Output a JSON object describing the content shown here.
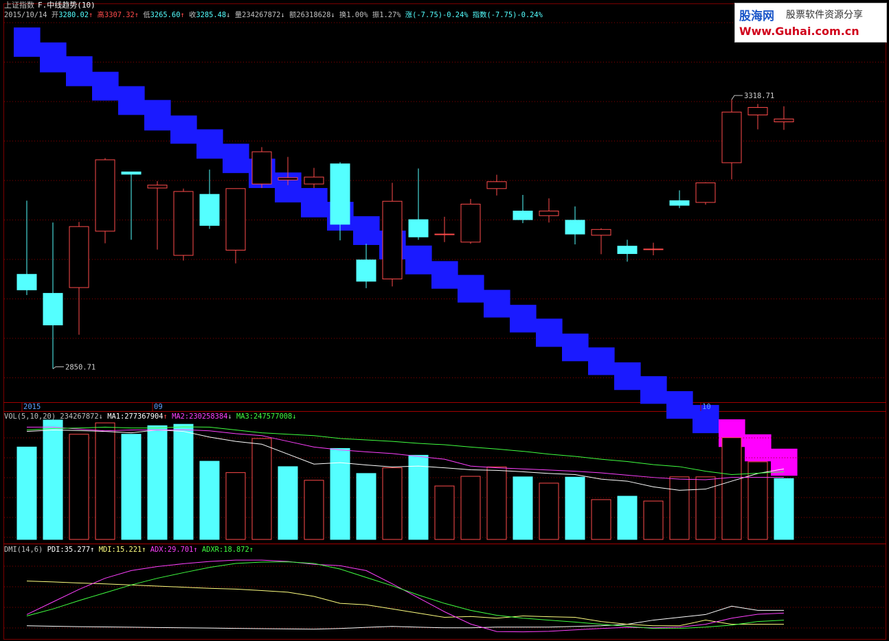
{
  "header": {
    "instrument": "上证指数",
    "formula": "F.中线趋势(10)",
    "date": "2015/10/14",
    "open_label": "开",
    "open": "3280.02",
    "open_arrow": "↑",
    "high_label": "高",
    "high": "3307.32",
    "high_arrow": "↑",
    "low_label": "低",
    "low": "3265.60",
    "low_arrow": "↑",
    "close_label": "收",
    "close": "3285.48",
    "close_arrow": "↓",
    "volume_label": "量",
    "volume": "234267872",
    "volume_arrow": "↓",
    "amount_label": "额",
    "amount": "26318628",
    "amount_arrow": "↓",
    "turnover": "换1.00%",
    "amplitude": "振1.27%",
    "change": "涨(-7.75)-0.24%",
    "index_change": "指数(-7.75)-0.24%"
  },
  "logo": {
    "name": "股海网",
    "slogan": "股票软件资源分享",
    "url": "Www.Guhai.com.cn"
  },
  "vol_header": {
    "title": "VOL(5,10,20)",
    "value": "234267872",
    "value_arrow": "↓",
    "ma1_label": "MA1:",
    "ma1": "277367904",
    "ma1_arrow": "↑",
    "ma2_label": "MA2:",
    "ma2": "230258384",
    "ma2_arrow": "↓",
    "ma3_label": "MA3:",
    "ma3": "247577008",
    "ma3_arrow": "↓"
  },
  "dmi_header": {
    "title": "DMI(14,6)",
    "pdi_label": "PDI:",
    "pdi": "35.277",
    "pdi_arrow": "↑",
    "mdi_label": "MDI:",
    "mdi": "15.221",
    "mdi_arrow": "↑",
    "adx_label": "ADX:",
    "adx": "29.701",
    "adx_arrow": "↑",
    "adxr_label": "ADXR:",
    "adxr": "18.872",
    "adxr_arrow": "↑"
  },
  "colors": {
    "background": "#000000",
    "up": "#ff4b4b",
    "down": "#54ffff",
    "trend_band": "#1a1aff",
    "trend_band_up": "#ff00ff",
    "grid": "#8b0000",
    "ma1": "#ffffff",
    "ma2": "#ff40ff",
    "ma3": "#40ff40",
    "pdi": "#ffffff",
    "mdi": "#ffff80",
    "adx": "#ff40ff",
    "adxr": "#40ff40"
  },
  "chart_data": [
    {
      "type": "candlestick",
      "title": "上证指数",
      "x_labels": [
        {
          "index": 0,
          "text": "2015"
        },
        {
          "index": 5,
          "text": "09"
        },
        {
          "index": 26,
          "text": "10"
        }
      ],
      "ylim": [
        2800,
        3450
      ],
      "annotations": [
        {
          "index": 1,
          "value": 2850.71,
          "text": "2850.71",
          "kind": "low"
        },
        {
          "index": 27,
          "value": 3318.71,
          "text": "3318.71",
          "kind": "high"
        }
      ],
      "candles": [
        {
          "o": 3015,
          "h": 3143,
          "l": 2979,
          "c": 2988
        },
        {
          "o": 2982,
          "h": 3105,
          "l": 2851,
          "c": 2927
        },
        {
          "o": 2992,
          "h": 3106,
          "l": 2910,
          "c": 3098
        },
        {
          "o": 3090,
          "h": 3217,
          "l": 3069,
          "c": 3214
        },
        {
          "o": 3193,
          "h": 3193,
          "l": 3075,
          "c": 3189
        },
        {
          "o": 3165,
          "h": 3177,
          "l": 3058,
          "c": 3170
        },
        {
          "o": 3048,
          "h": 3164,
          "l": 3039,
          "c": 3159
        },
        {
          "o": 3154,
          "h": 3197,
          "l": 3094,
          "c": 3100
        },
        {
          "o": 3057,
          "h": 3156,
          "l": 3034,
          "c": 3164
        },
        {
          "o": 3172,
          "h": 3236,
          "l": 3165,
          "c": 3228
        },
        {
          "o": 3179,
          "h": 3219,
          "l": 3170,
          "c": 3183
        },
        {
          "o": 3172,
          "h": 3200,
          "l": 3165,
          "c": 3184
        },
        {
          "o": 3207,
          "h": 3210,
          "l": 3074,
          "c": 3102
        },
        {
          "o": 3040,
          "h": 3068,
          "l": 2991,
          "c": 3003
        },
        {
          "o": 3007,
          "h": 3174,
          "l": 2994,
          "c": 3142
        },
        {
          "o": 3110,
          "h": 3199,
          "l": 3075,
          "c": 3080
        },
        {
          "o": 3085,
          "h": 3115,
          "l": 3071,
          "c": 3085
        },
        {
          "o": 3071,
          "h": 3146,
          "l": 3068,
          "c": 3137
        },
        {
          "o": 3164,
          "h": 3188,
          "l": 3152,
          "c": 3176
        },
        {
          "o": 3125,
          "h": 3153,
          "l": 3104,
          "c": 3110
        },
        {
          "o": 3117,
          "h": 3147,
          "l": 3105,
          "c": 3125
        },
        {
          "o": 3109,
          "h": 3133,
          "l": 3067,
          "c": 3085
        },
        {
          "o": 3083,
          "h": 3095,
          "l": 3050,
          "c": 3093
        },
        {
          "o": 3064,
          "h": 3075,
          "l": 3037,
          "c": 3051
        },
        {
          "o": 3059,
          "h": 3070,
          "l": 3048,
          "c": 3059
        },
        {
          "o": 3143,
          "h": 3161,
          "l": 3130,
          "c": 3135
        },
        {
          "o": 3140,
          "h": 3175,
          "l": 3136,
          "c": 3174
        },
        {
          "o": 3209,
          "h": 3319,
          "l": 3180,
          "c": 3297
        },
        {
          "o": 3292,
          "h": 3311,
          "l": 3267,
          "c": 3305
        },
        {
          "o": 3280,
          "h": 3307,
          "l": 3266,
          "c": 3285
        }
      ],
      "trend_band": {
        "upper": [
          3444,
          3418,
          3394,
          3367,
          3342,
          3318,
          3291,
          3267,
          3242,
          3216,
          3192,
          3165,
          3141,
          3116,
          3091,
          3065,
          3038,
          3014,
          2988,
          2962,
          2938,
          2912,
          2888,
          2862,
          2838,
          2812,
          2788,
          2763,
          2737,
          2712
        ],
        "lower": [
          3393,
          3366,
          3342,
          3317,
          3292,
          3265,
          3242,
          3216,
          3191,
          3165,
          3140,
          3114,
          3091,
          3066,
          3041,
          3015,
          2990,
          2966,
          2940,
          2914,
          2889,
          2864,
          2840,
          2814,
          2790,
          2764,
          2739,
          2715,
          2690,
          2665
        ],
        "up_from_index": 27
      }
    },
    {
      "type": "bar",
      "title": "VOL(5,10,20)",
      "ylim": [
        0,
        420000000
      ],
      "values": [
        325000000,
        432000000,
        370000000,
        410000000,
        370000000,
        400000000,
        405000000,
        275000000,
        235000000,
        355000000,
        256000000,
        208000000,
        320000000,
        232000000,
        252000000,
        296000000,
        188000000,
        222000000,
        255000000,
        220000000,
        198000000,
        219000000,
        140000000,
        152000000,
        135000000,
        220000000,
        220000000,
        358000000,
        273000000,
        214000000
      ],
      "up": [
        false,
        false,
        true,
        true,
        false,
        false,
        false,
        false,
        true,
        true,
        false,
        true,
        false,
        false,
        true,
        false,
        true,
        true,
        true,
        false,
        true,
        false,
        true,
        false,
        true,
        true,
        true,
        true,
        true,
        false
      ],
      "series": [
        {
          "name": "MA1",
          "values": [
            380000000,
            385000000,
            383000000,
            380000000,
            375000000,
            385000000,
            380000000,
            360000000,
            345000000,
            335000000,
            300000000,
            265000000,
            270000000,
            262000000,
            255000000,
            258000000,
            252000000,
            245000000,
            243000000,
            238000000,
            232000000,
            228000000,
            212000000,
            205000000,
            185000000,
            173000000,
            177000000,
            205000000,
            232000000,
            248000000
          ]
        },
        {
          "name": "MA2",
          "values": [
            395000000,
            395000000,
            388000000,
            382000000,
            385000000,
            385000000,
            386000000,
            382000000,
            372000000,
            365000000,
            345000000,
            325000000,
            315000000,
            308000000,
            302000000,
            292000000,
            282000000,
            258000000,
            252000000,
            248000000,
            244000000,
            240000000,
            234000000,
            226000000,
            218000000,
            212000000,
            210000000,
            218000000,
            218000000,
            218000000
          ]
        },
        {
          "name": "MA3",
          "values": [
            385000000,
            390000000,
            392000000,
            395000000,
            392000000,
            392000000,
            396000000,
            395000000,
            385000000,
            375000000,
            370000000,
            365000000,
            355000000,
            350000000,
            345000000,
            338000000,
            333000000,
            325000000,
            318000000,
            310000000,
            300000000,
            292000000,
            282000000,
            274000000,
            263000000,
            256000000,
            240000000,
            228000000,
            233000000,
            238000000
          ]
        }
      ]
    },
    {
      "type": "line",
      "title": "DMI(14,6)",
      "ylim": [
        5,
        65
      ],
      "series": [
        {
          "name": "PDI",
          "values": [
            14,
            13.6,
            13.3,
            13.1,
            12.9,
            12.7,
            12.5,
            12.3,
            12.1,
            11.9,
            11.7,
            11.5,
            12.0,
            12.8,
            13.5,
            12.9,
            12.5,
            12.5,
            13.0,
            13.0,
            13.0,
            13.5,
            14.0,
            15.0,
            18.0,
            20.0,
            22.0,
            28.0,
            25.0,
            25.0
          ]
        },
        {
          "name": "MDI",
          "values": [
            46,
            45.4,
            44.6,
            44.0,
            43.2,
            42.4,
            41.6,
            40.8,
            40.2,
            39.2,
            38.0,
            35.0,
            30.0,
            29.0,
            26.0,
            23.0,
            20.0,
            20.6,
            19.4,
            21.0,
            20.4,
            20.0,
            17.0,
            15.0,
            14.0,
            14.0,
            18.0,
            15.0,
            15.0,
            15.0
          ]
        },
        {
          "name": "ADX",
          "values": [
            22,
            31.0,
            40.0,
            48.0,
            53.5,
            56.4,
            58.4,
            60.0,
            61.0,
            61.0,
            60.0,
            58.0,
            57.0,
            53.5,
            44.0,
            34.0,
            24.0,
            15.2,
            9.8,
            9.6,
            10.0,
            11.0,
            12.0,
            12.8,
            12.5,
            13.0,
            15.0,
            19.4,
            22.2,
            23.0
          ]
        },
        {
          "name": "ADXR",
          "values": [
            21,
            26.0,
            32.0,
            37.6,
            43.2,
            48.0,
            52.0,
            55.8,
            58.6,
            59.6,
            59.8,
            58.6,
            54.6,
            48.6,
            42.6,
            36.0,
            30.0,
            25.0,
            21.5,
            19.4,
            18.0,
            16.6,
            15.0,
            13.6,
            12.0,
            12.1,
            13.0,
            14.4,
            17.0,
            18.0
          ]
        }
      ]
    }
  ]
}
